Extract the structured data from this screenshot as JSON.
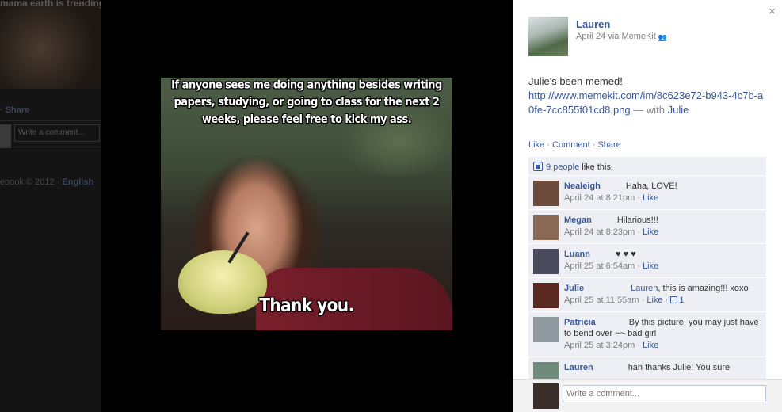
{
  "background": {
    "title_fragment": "mama earth is trending",
    "share_label": "· Share",
    "comment_placeholder": "Write a comment...",
    "footer_text": "ebook © 2012 ·",
    "footer_lang": "English"
  },
  "photo": {
    "meme_top": "If anyone sees me doing anything besides writing papers, studying, or going to class for the next 2 weeks, please feel free to kick my ass.",
    "meme_bottom": "Thank you."
  },
  "panel": {
    "close_glyph": "×",
    "author": "Lauren",
    "date": "April 24",
    "via": " via ",
    "app": "MemeKit",
    "message_line": "Julie's been memed!",
    "link": "http://www.memekit.com/im/8c623e72-b943-4c7b-a0fe-7cc855f01cd8.png",
    "with_label": " — with ",
    "tagged": "Julie",
    "actions": {
      "like": "Like",
      "comment": "Comment",
      "share": "Share",
      "sep": " · "
    },
    "likes_count": "9 people",
    "likes_suffix": " like this.",
    "comments": [
      {
        "author": "Nealeigh",
        "text": "Haha, LOVE!",
        "time": "April 24 at 8:21pm",
        "like": "Like",
        "avatar_color": "#6d4b3c"
      },
      {
        "author": "Megan",
        "text": "Hilarious!!!",
        "time": "April 24 at 8:23pm",
        "like": "Like",
        "avatar_color": "#8a6a55"
      },
      {
        "author": "Luann",
        "text": "♥ ♥ ♥",
        "time": "April 25 at 6:54am",
        "like": "Like",
        "avatar_color": "#4a4a5c"
      },
      {
        "author": "Julie",
        "mention": "Lauren",
        "text": ", this is amazing!!! xoxo",
        "time": "April 25 at 11:55am",
        "like": "Like",
        "likes": "1",
        "avatar_color": "#5a2a22"
      },
      {
        "author": "Patricia",
        "text": "By this picture, you may just have to bend over ~~ bad girl",
        "time": "April 25 at 3:24pm",
        "like": "Like",
        "avatar_color": "#8e9aa0"
      },
      {
        "author": "Lauren",
        "text": "hah thanks Julie! You sure",
        "time": "",
        "like": "",
        "avatar_color": "#6f8a7a"
      }
    ],
    "composer_placeholder": "Write a comment..."
  }
}
